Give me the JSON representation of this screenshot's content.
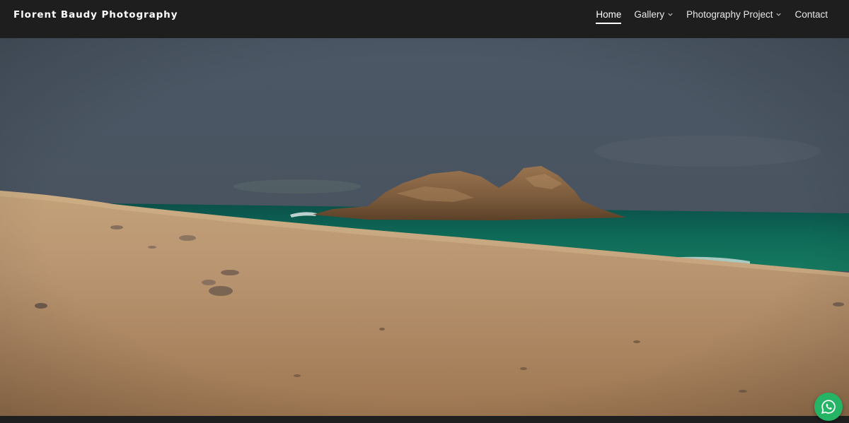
{
  "site": {
    "brand": "Florent Baudy Photography"
  },
  "nav": {
    "items": [
      {
        "label": "Home",
        "active": true,
        "has_dropdown": false
      },
      {
        "label": "Gallery",
        "active": false,
        "has_dropdown": true
      },
      {
        "label": "Photography Project",
        "active": false,
        "has_dropdown": true
      },
      {
        "label": "Contact",
        "active": false,
        "has_dropdown": false
      }
    ]
  },
  "hero": {
    "image_alt": "Sandy beach with a rocky islet in a turquoise sea under a stormy sky"
  },
  "floating": {
    "whatsapp_icon": "whatsapp-icon"
  },
  "colors": {
    "header_bg": "#1e1e1f",
    "whatsapp_green": "#25b465",
    "sky": "#4a5664",
    "sea": "#0f6654",
    "sand": "#b8956c"
  }
}
